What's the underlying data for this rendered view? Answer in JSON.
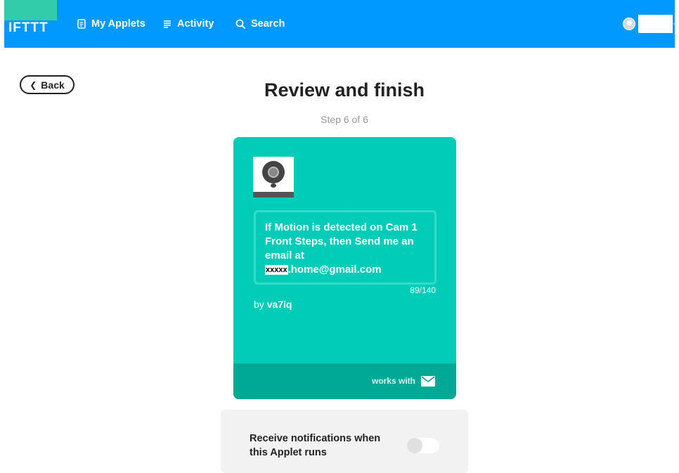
{
  "nav": {
    "logo": "IFTTT",
    "my_applets": "My Applets",
    "activity": "Activity",
    "search": "Search"
  },
  "back_label": "Back",
  "page": {
    "title": "Review and finish",
    "step": "Step 6 of 6"
  },
  "applet": {
    "service_icon": "wyze-camera-icon",
    "title_prefix": "If Motion is detected on Cam 1 Front Steps, then Send me an email at",
    "title_redacted": "xxxxx",
    "title_suffix": ".home@gmail.com",
    "char_count": "89/140",
    "by_label": "by",
    "author": "va7iq",
    "works_with": "works with",
    "works_with_icon": "email-icon",
    "card_color": "#00ccb8",
    "footer_color": "#00a896"
  },
  "notifications": {
    "label": "Receive notifications when this Applet runs",
    "enabled": false
  },
  "colors": {
    "navbar": "#0099ff",
    "logo_accent": "#33ccaa"
  }
}
